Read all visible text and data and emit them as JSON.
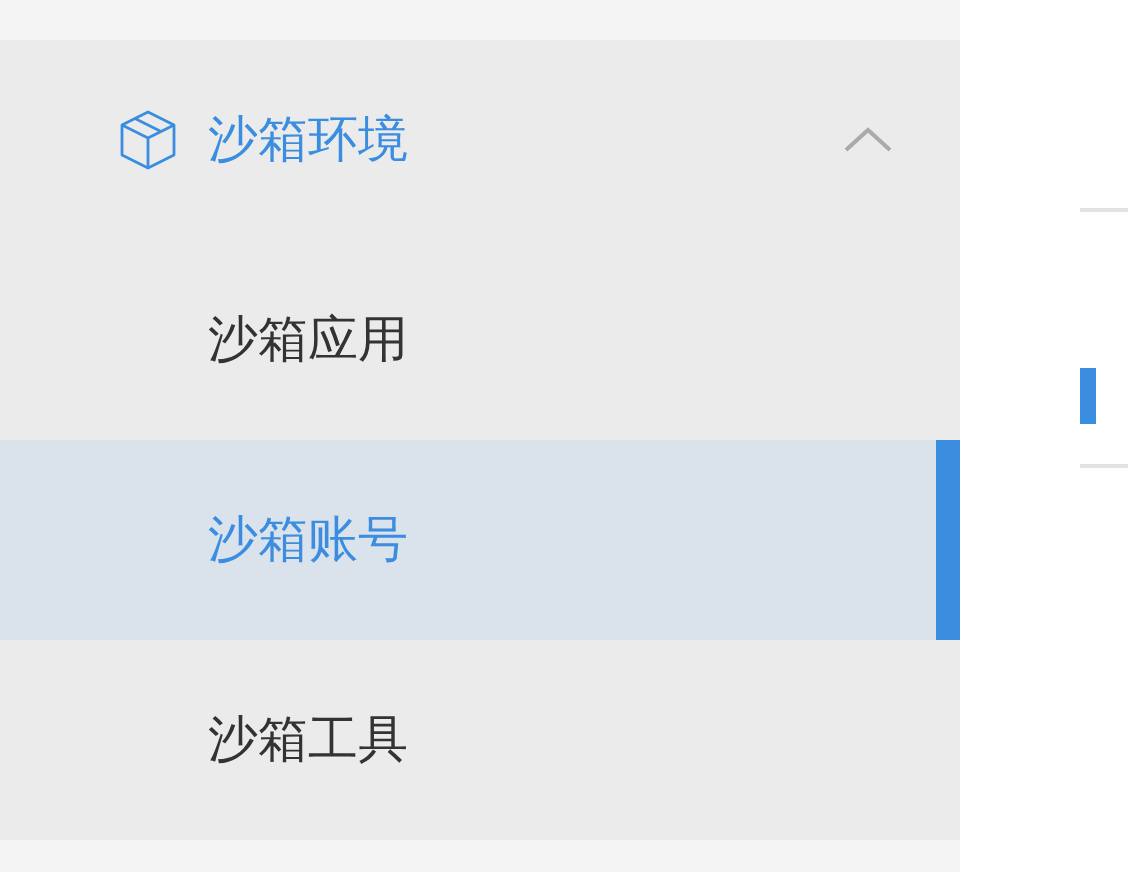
{
  "sidebar": {
    "group": {
      "title": "沙箱环境",
      "expanded": true,
      "items": [
        {
          "label": "沙箱应用",
          "selected": false
        },
        {
          "label": "沙箱账号",
          "selected": true
        },
        {
          "label": "沙箱工具",
          "selected": false
        }
      ]
    }
  }
}
